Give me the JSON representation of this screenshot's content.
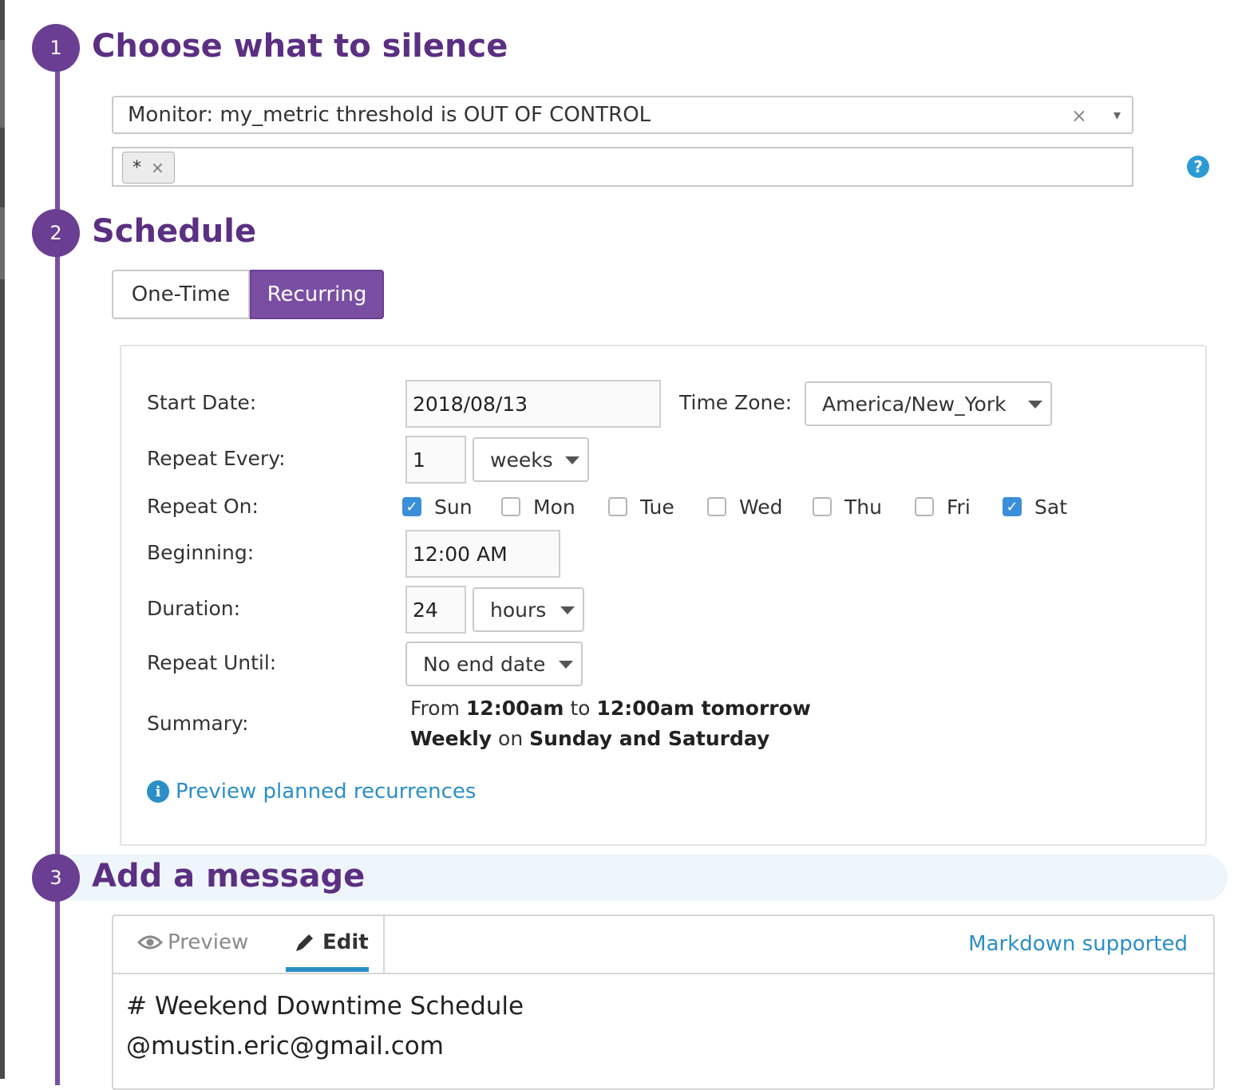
{
  "steps": [
    {
      "number": "1",
      "title": "Choose what to silence"
    },
    {
      "number": "2",
      "title": "Schedule"
    },
    {
      "number": "3",
      "title": "Add a message"
    }
  ],
  "monitor": {
    "value": "Monitor: my_metric threshold is OUT OF CONTROL",
    "clear": "×",
    "caret": "▾"
  },
  "scope": {
    "tag": "*",
    "remove": "×",
    "help": "?"
  },
  "schedule": {
    "tabs": {
      "one_time": "One-Time",
      "recurring": "Recurring",
      "active": "Recurring"
    },
    "labels": {
      "start_date": "Start Date:",
      "time_zone": "Time Zone:",
      "repeat_every": "Repeat Every:",
      "repeat_on": "Repeat On:",
      "beginning": "Beginning:",
      "duration": "Duration:",
      "repeat_until": "Repeat Until:",
      "summary": "Summary:"
    },
    "start_date": "2018/08/13",
    "time_zone": "America/New_York",
    "repeat_every": {
      "value": "1",
      "unit": "weeks"
    },
    "days": [
      {
        "label": "Sun",
        "checked": true
      },
      {
        "label": "Mon",
        "checked": false
      },
      {
        "label": "Tue",
        "checked": false
      },
      {
        "label": "Wed",
        "checked": false
      },
      {
        "label": "Thu",
        "checked": false
      },
      {
        "label": "Fri",
        "checked": false
      },
      {
        "label": "Sat",
        "checked": true
      }
    ],
    "beginning": "12:00 AM",
    "duration": {
      "value": "24",
      "unit": "hours"
    },
    "repeat_until": "No end date",
    "summary": {
      "from": "From",
      "start": "12:00am",
      "to": "to",
      "end": "12:00am tomorrow",
      "frequency": "Weekly",
      "on": "on",
      "days": "Sunday and Saturday"
    },
    "preview_link": "Preview planned recurrences"
  },
  "message": {
    "tabs": {
      "preview": "Preview",
      "edit": "Edit",
      "active": "Edit"
    },
    "markdown_link": "Markdown supported",
    "text": "# Weekend Downtime Schedule\n@mustin.eric@gmail.com"
  },
  "colors": {
    "accent": "#6a3e92",
    "link": "#2c8ec6",
    "checkbox": "#3b8fd9"
  }
}
